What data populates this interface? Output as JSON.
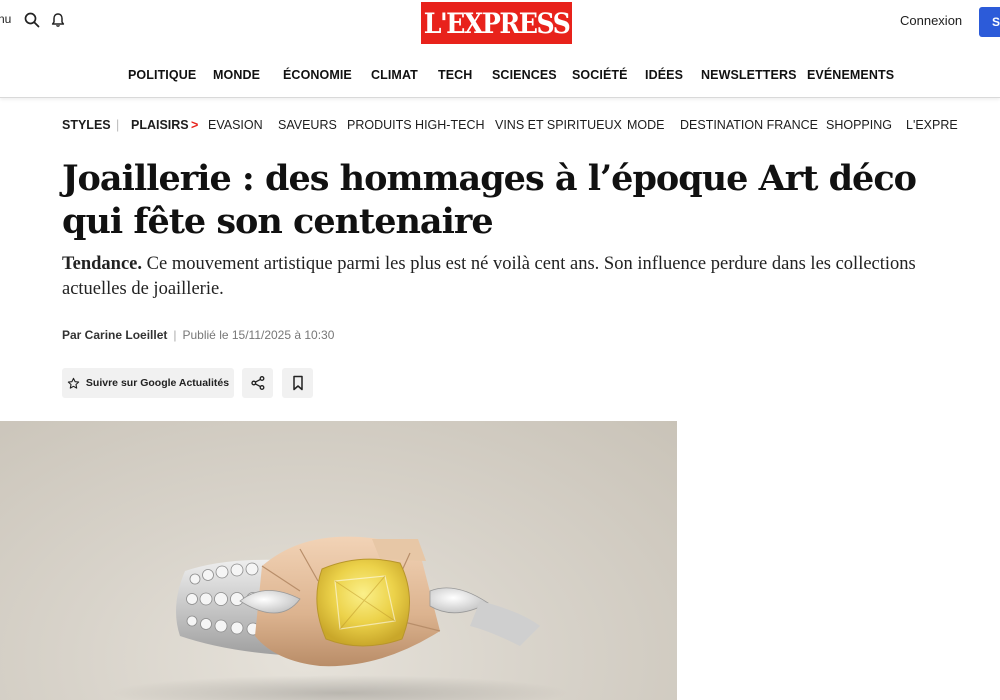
{
  "header": {
    "menu_label": "nu",
    "logo_text": "L'EXPRESS",
    "connexion_label": "Connexion",
    "subscribe_label": "S'",
    "icons": [
      "search-icon",
      "bell-icon"
    ],
    "brand_color": "#e8221b",
    "accent_color": "#2c5bd9"
  },
  "main_nav": {
    "items": [
      "POLITIQUE",
      "MONDE",
      "ÉCONOMIE",
      "CLIMAT",
      "TECH",
      "SCIENCES",
      "SOCIÉTÉ",
      "IDÉES",
      "NEWSLETTERS",
      "EVÉNEMENTS"
    ]
  },
  "sub_nav": {
    "section": "STYLES",
    "separator": "|",
    "current": "PLAISIRS",
    "chevron": ">",
    "items": [
      "EVASION",
      "SAVEURS",
      "PRODUITS HIGH-TECH",
      "VINS ET SPIRITUEUX",
      "MODE",
      "DESTINATION FRANCE",
      "SHOPPING",
      "L'EXPRE"
    ]
  },
  "article": {
    "title": "Joaillerie : des hommages à l’époque Art déco qui fête son centenaire",
    "lead_tag": "Tendance.",
    "lead_text": " Ce mouvement artistique parmi les plus est né voilà cent ans. Son influence perdure dans les collections actuelles de joaillerie.",
    "byline_author": "Par Carine Loeillet",
    "byline_separator": "|",
    "byline_date": "Publié le 15/11/2025 à 10:30"
  },
  "actions": {
    "follow_label": "Suivre sur Google Actualités",
    "icons": [
      "star-icon",
      "share-icon",
      "bookmark-icon"
    ]
  },
  "hero": {
    "subject": "ring-photo"
  }
}
